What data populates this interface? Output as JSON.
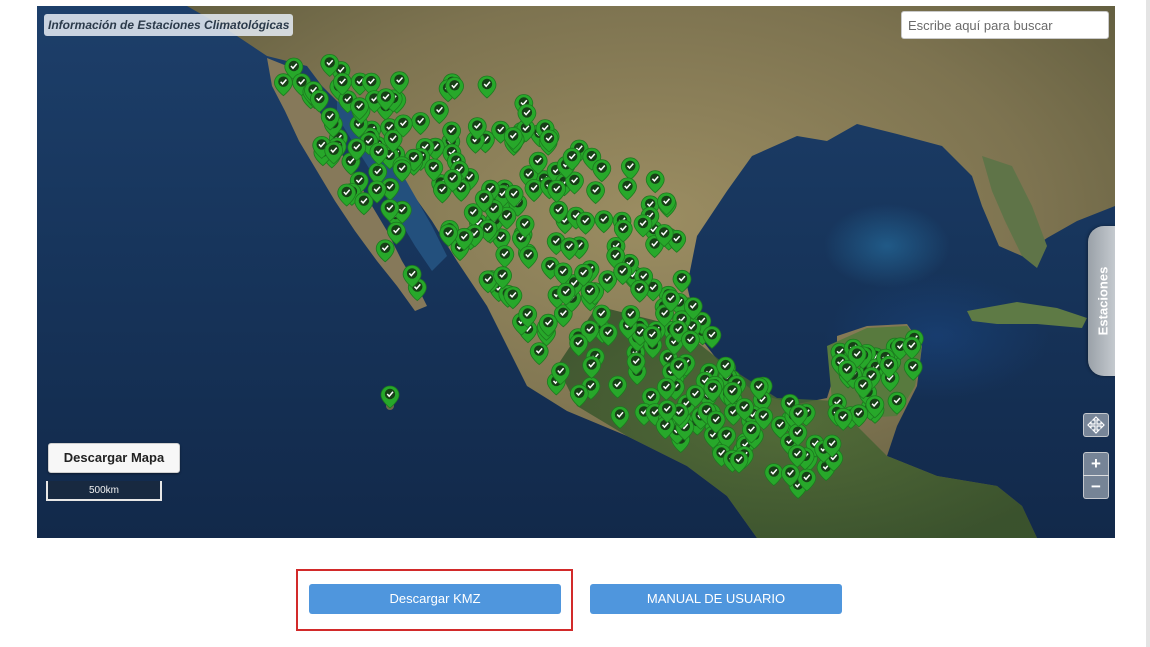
{
  "map": {
    "title": "Información de Estaciones Climatológicas",
    "search_placeholder": "Escribe aquí para buscar",
    "download_map_label": "Descargar Mapa",
    "scale_label": "500km",
    "side_tab_label": "Estaciones",
    "zoom_in_label": "+",
    "zoom_out_label": "−",
    "pan_icon": "pan-move-icon",
    "marker_icon": "station-marker-check-icon",
    "colors": {
      "marker": "#27a82a",
      "ocean": "#17355c",
      "land": "#7d7350",
      "vegetation": "#3e5a2c"
    }
  },
  "actions": {
    "download_kmz_label": "Descargar KMZ",
    "manual_label": "MANUAL DE USUARIO",
    "button_color": "#4f96dd",
    "highlight_color": "#d22a2a"
  }
}
